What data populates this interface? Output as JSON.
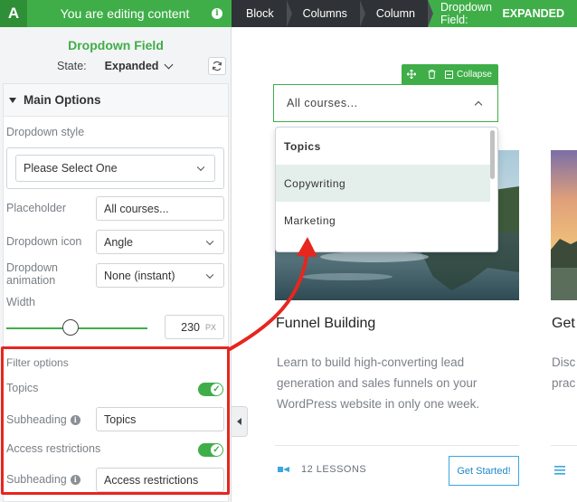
{
  "topbar": {
    "logo_letter": "A",
    "editing_text": "You are editing content",
    "breadcrumbs": [
      "Block",
      "Columns",
      "Column"
    ],
    "active_crumb_prefix": "Dropdown Field:",
    "active_crumb_state": "EXPANDED"
  },
  "panel": {
    "title": "Dropdown Field",
    "state_label": "State:",
    "state_value": "Expanded",
    "section_title": "Main Options",
    "dropdown_style_label": "Dropdown style",
    "dropdown_style_value": "Please Select One",
    "placeholder_label": "Placeholder",
    "placeholder_value": "All courses...",
    "dropdown_icon_label": "Dropdown icon",
    "dropdown_icon_value": "Angle",
    "dropdown_animation_label_line1": "Dropdown",
    "dropdown_animation_label_line2": "animation",
    "dropdown_animation_value": "None (instant)",
    "width_label": "Width",
    "width_value": "230",
    "width_unit": "PX",
    "filter_options_label": "Filter options",
    "topics_label": "Topics",
    "topics_enabled": true,
    "subheading_label": "Subheading",
    "topics_subheading_value": "Topics",
    "access_label": "Access restrictions",
    "access_enabled": true,
    "access_subheading_value": "Access restrictions"
  },
  "canvas": {
    "toolbar_collapse": "Collapse",
    "dropdown_value": "All courses...",
    "menu_items": [
      "Topics",
      "Copywriting",
      "Marketing"
    ],
    "card1": {
      "title": "Funnel Building",
      "description": "Learn to build high-converting lead generation and sales funnels on your WordPress website in only one week.",
      "lessons": "12 LESSONS",
      "button": "Get Started!"
    },
    "card2": {
      "title": "Get",
      "description_line1": "Disc",
      "description_line2": "prac"
    }
  },
  "colors": {
    "brand_green": "#3fae49",
    "dark_bar": "#2f3337",
    "highlight_red": "#e6261f",
    "selected_item_bg": "#e4efec",
    "button_blue": "#3aa6e0"
  },
  "icons": [
    "info-icon",
    "chevron-down-icon",
    "refresh-icon",
    "triangle-down-icon",
    "check-icon",
    "move-icon",
    "trash-icon",
    "collapse-icon",
    "chevron-up-icon",
    "lessons-icon",
    "list-icon",
    "arrow-left-icon"
  ]
}
